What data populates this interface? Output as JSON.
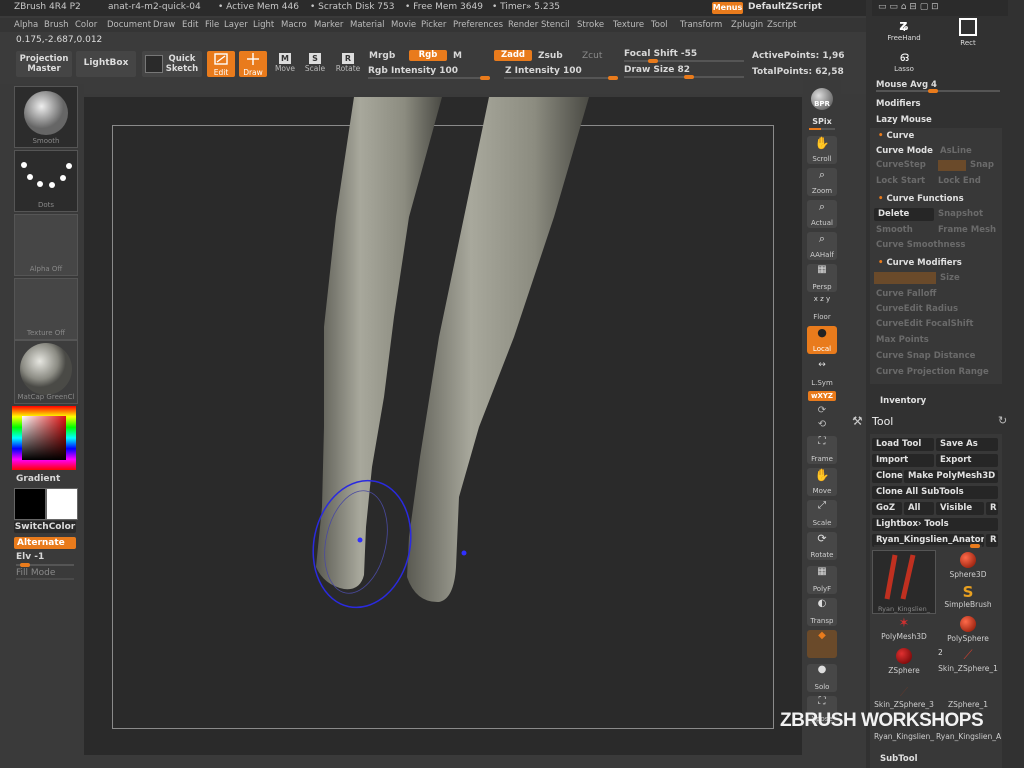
{
  "titlebar": {
    "app": "ZBrush 4R4 P2",
    "doc": "anat-r4-m2-quick-04",
    "active_mem": "• Active Mem 446",
    "scratch_disk": "• Scratch Disk 753",
    "free_mem": "• Free Mem 3649",
    "timer": "• Timer» 5.235",
    "menus_btn": "Menus",
    "script": "DefaultZScript"
  },
  "menubar": [
    "Alpha",
    "Brush",
    "Color",
    "Document",
    "Draw",
    "Edit",
    "File",
    "Layer",
    "Light",
    "Macro",
    "Marker",
    "Material",
    "Movie",
    "Picker",
    "Preferences",
    "Render",
    "Stencil",
    "Stroke",
    "Texture",
    "Tool",
    "Transform",
    "Zplugin",
    "Zscript"
  ],
  "coords": "0.175,-2.687,0.012",
  "shelf": {
    "projection_master": "Projection Master",
    "lightbox": "LightBox",
    "quick_sketch": "Quick Sketch",
    "edit": "Edit",
    "draw": "Draw",
    "move": "Move",
    "scale": "Scale",
    "rotate": "Rotate",
    "mrgb": "Mrgb",
    "rgb": "Rgb",
    "m": "M",
    "rgb_intensity": "Rgb Intensity 100",
    "zadd": "Zadd",
    "zsub": "Zsub",
    "zcut": "Zcut",
    "z_intensity": "Z Intensity 100",
    "focal_shift": "Focal Shift -55",
    "draw_size": "Draw Size 82",
    "active_points": "ActivePoints: 1,96",
    "total_points": "TotalPoints: 62,58"
  },
  "left": {
    "brush": "Smooth",
    "stroke": "Dots",
    "alpha": "Alpha Off",
    "texture": "Texture Off",
    "material": "MatCap GreenCl",
    "gradient": "Gradient",
    "switch_color": "SwitchColor",
    "alternate": "Alternate",
    "elv": "Elv -1",
    "fill_mode": "Fill Mode"
  },
  "right": {
    "bpr": "BPR",
    "spix": "SPix",
    "scroll": "Scroll",
    "zoom": "Zoom",
    "actual": "Actual",
    "aahalf": "AAHalf",
    "persp": "Persp",
    "floor": "Floor",
    "local": "Local",
    "lsym": "L.Sym",
    "xyz": "wXYZ",
    "frame": "Frame",
    "move": "Move",
    "scale": "Scale",
    "rotate": "Rotate",
    "polyf": "PolyF",
    "transp": "Transp",
    "solo": "Solo",
    "xpose": "Xpose"
  },
  "panel": {
    "freehand": "FreeHand",
    "rect": "Rect",
    "lasso": "Lasso",
    "mouse_avg": "Mouse Avg 4",
    "modifiers": "Modifiers",
    "lazy_mouse": "Lazy Mouse",
    "curve": "Curve",
    "curve_mode": "Curve Mode",
    "as_line": "AsLine",
    "curve_step": "CurveStep",
    "snap": "Snap",
    "lock_start": "Lock Start",
    "lock_end": "Lock End",
    "curve_functions": "Curve Functions",
    "delete": "Delete",
    "snapshot": "Snapshot",
    "smooth": "Smooth",
    "frame_mesh": "Frame Mesh",
    "curve_smoothness": "Curve Smoothness",
    "curve_modifiers": "Curve Modifiers",
    "size": "Size",
    "curve_falloff": "Curve Falloff",
    "curve_edit_radius": "CurveEdit Radius",
    "curve_edit_focal": "CurveEdit FocalShift",
    "max_points": "Max Points",
    "curve_snap_distance": "Curve Snap Distance",
    "curve_projection_range": "Curve Projection Range",
    "inventory": "Inventory",
    "tool": "Tool",
    "load_tool": "Load Tool",
    "save_as": "Save As",
    "import": "Import",
    "export": "Export",
    "clone": "Clone",
    "make_polymesh": "Make PolyMesh3D",
    "clone_all": "Clone All SubTools",
    "goz": "GoZ",
    "all": "All",
    "visible": "Visible",
    "r": "R",
    "lightbox_tools": "Lightbox› Tools",
    "current_tool": "Ryan_Kingslien_Anator",
    "tiles": [
      "Ryan_Kingslien_",
      "Sphere3D",
      "SimpleBrush",
      "PolyMesh3D",
      "PolySphere",
      "ZSphere",
      "Skin_ZSphere_1",
      "Skin_ZSphere_3",
      "ZSphere_1",
      "Ryan_Kingslien_",
      "Ryan_Kingslien_A"
    ],
    "two": "2",
    "subtool": "SubTool"
  },
  "watermark": "ZBRUSH WORKSHOPS",
  "colors": {
    "accent": "#e97b1c",
    "bg": "#3a3a3a",
    "viewport": "#2a2a2a"
  }
}
